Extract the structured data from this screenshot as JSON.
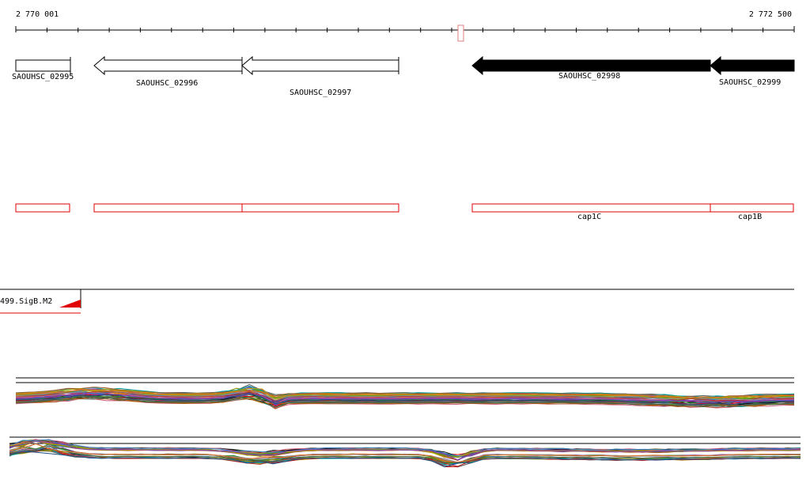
{
  "ruler": {
    "start_label": "2 770 001",
    "end_label": "2 772 500"
  },
  "genes": [
    {
      "id": "SAOUHSC_02995",
      "strand": "none",
      "style": "outline"
    },
    {
      "id": "SAOUHSC_02996",
      "strand": "reverse",
      "style": "outline"
    },
    {
      "id": "SAOUHSC_02997",
      "strand": "reverse",
      "style": "outline"
    },
    {
      "id": "SAOUHSC_02998",
      "strand": "reverse",
      "style": "filled"
    },
    {
      "id": "SAOUHSC_02999",
      "strand": "reverse",
      "style": "filled"
    }
  ],
  "features": [
    {
      "name": ""
    },
    {
      "name": ""
    },
    {
      "name": ""
    },
    {
      "name": "cap1C"
    },
    {
      "name": "cap1B"
    }
  ],
  "motif_track": {
    "label": "499.SigB.M2"
  },
  "colors": {
    "feature_outline": "#e00000",
    "gene_fill": "#000000",
    "motif_fill": "#e00000"
  }
}
